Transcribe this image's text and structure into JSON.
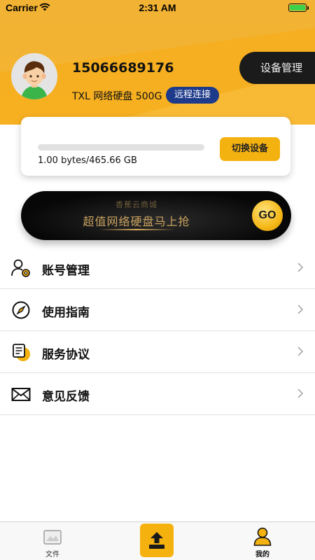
{
  "status_bar": {
    "carrier": "Carrier",
    "time": "2:31 AM"
  },
  "profile": {
    "phone": "15066689176",
    "device_info": "TXL 网络硬盘 500G",
    "remote_badge": "远程连接",
    "device_mgmt_button": "设备管理"
  },
  "storage": {
    "usage_text": "1.00 bytes/465.66 GB",
    "used_fraction": 0.0,
    "switch_button": "切换设备"
  },
  "banner": {
    "shop_name": "香蕉云商城",
    "slogan": "超值网络硬盘马上抢",
    "go_label": "GO"
  },
  "menu": [
    {
      "label": "账号管理",
      "icon": "account-settings-icon"
    },
    {
      "label": "使用指南",
      "icon": "compass-icon"
    },
    {
      "label": "服务协议",
      "icon": "document-icon"
    },
    {
      "label": "意见反馈",
      "icon": "mail-icon"
    }
  ],
  "tabs": {
    "files": "文件",
    "mine": "我的"
  },
  "colors": {
    "accent": "#f4b211",
    "header": "#f2b233",
    "badge": "#1e3a8a",
    "dark": "#1b1b1b"
  }
}
